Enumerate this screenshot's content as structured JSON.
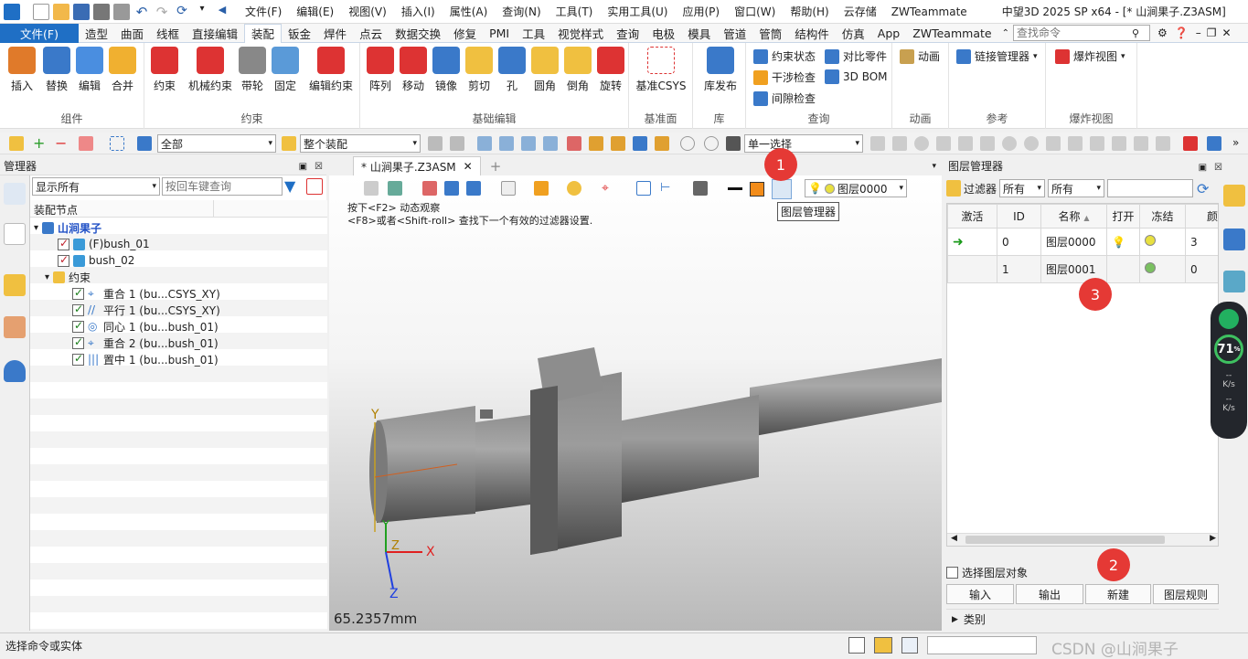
{
  "titlebar": {
    "menu": [
      "文件(F)",
      "编辑(E)",
      "视图(V)",
      "插入(I)",
      "属性(A)",
      "查询(N)",
      "工具(T)",
      "实用工具(U)",
      "应用(P)",
      "窗口(W)",
      "帮助(H)",
      "云存储",
      "ZWTeammate"
    ],
    "title": "中望3D 2025 SP x64 - [* 山涧果子.Z3ASM]"
  },
  "tabs": [
    "文件(F)",
    "造型",
    "曲面",
    "线框",
    "直接编辑",
    "装配",
    "钣金",
    "焊件",
    "点云",
    "数据交换",
    "修复",
    "PMI",
    "工具",
    "视觉样式",
    "查询",
    "电极",
    "模具",
    "管道",
    "管筒",
    "结构件",
    "仿真",
    "App",
    "ZWTeammate"
  ],
  "search": {
    "placeholder": "查找命令"
  },
  "ribbon": {
    "groups": [
      "组件",
      "约束",
      "基础编辑",
      "基准面",
      "库",
      "查询",
      "动画",
      "参考",
      "爆炸视图"
    ],
    "component": [
      "插入",
      "替换",
      "编辑",
      "合并"
    ],
    "constraint": [
      "约束",
      "机械约束",
      "带轮",
      "固定",
      "编辑约束"
    ],
    "edit": [
      "阵列",
      "移动",
      "镜像",
      "剪切",
      "孔",
      "圆角",
      "倒角",
      "旋转"
    ],
    "datum": [
      "基准CSYS"
    ],
    "lib": [
      "库发布"
    ],
    "query": [
      "约束状态",
      "对比零件",
      "干涉检查",
      "3D BOM",
      "间隙检查"
    ],
    "anim": [
      "动画"
    ],
    "ref": [
      "链接管理器"
    ],
    "explode": [
      "爆炸视图"
    ]
  },
  "toolbar2": {
    "filter": "全部",
    "scope": "整个装配",
    "select": "单一选择"
  },
  "manager": {
    "title": "管理器",
    "display": "显示所有",
    "search_placeholder": "按回车键查询",
    "col": "装配节点",
    "root": "山涧果子",
    "nodes": [
      "(F)bush_01",
      "bush_02"
    ],
    "constraint_folder": "约束",
    "constraints": [
      "重合 1 (bu...CSYS_XY)",
      "平行 1 (bu...CSYS_XY)",
      "同心 1 (bu...bush_01)",
      "重合 2 (bu...bush_01)",
      "置中 1 (bu...bush_01)"
    ]
  },
  "viewport": {
    "tab": "* 山涧果子.Z3ASM",
    "hint1": "按下<F2> 动态观察",
    "hint2": "<F8>或者<Shift-roll> 查找下一个有效的过滤器设置.",
    "layer_combo": "图层0000",
    "tooltip": "图层管理器",
    "measure": "65.2357mm",
    "axes": [
      "Y",
      "X",
      "Z",
      "Y",
      "Z",
      "X"
    ]
  },
  "layer_manager": {
    "title": "图层管理器",
    "filter_label": "过滤器",
    "filter1": "所有",
    "filter2": "所有",
    "columns": [
      "激活",
      "ID",
      "名称",
      "打开",
      "冻结",
      "颜"
    ],
    "rows": [
      {
        "id": "0",
        "name": "图层0000",
        "last": "3"
      },
      {
        "id": "1",
        "name": "图层0001",
        "last": "0"
      }
    ],
    "select_label": "选择图层对象",
    "buttons": [
      "输入",
      "输出",
      "新建",
      "图层规则"
    ],
    "category": "类别"
  },
  "right_widget": {
    "percent": "71",
    "unit": "%",
    "rate1": "--",
    "rate1u": "K/s",
    "rate2": "--",
    "rate2u": "K/s"
  },
  "badges": [
    "1",
    "2",
    "3"
  ],
  "status": {
    "text": "选择命令或实体",
    "watermark": "CSDN @山涧果子"
  }
}
